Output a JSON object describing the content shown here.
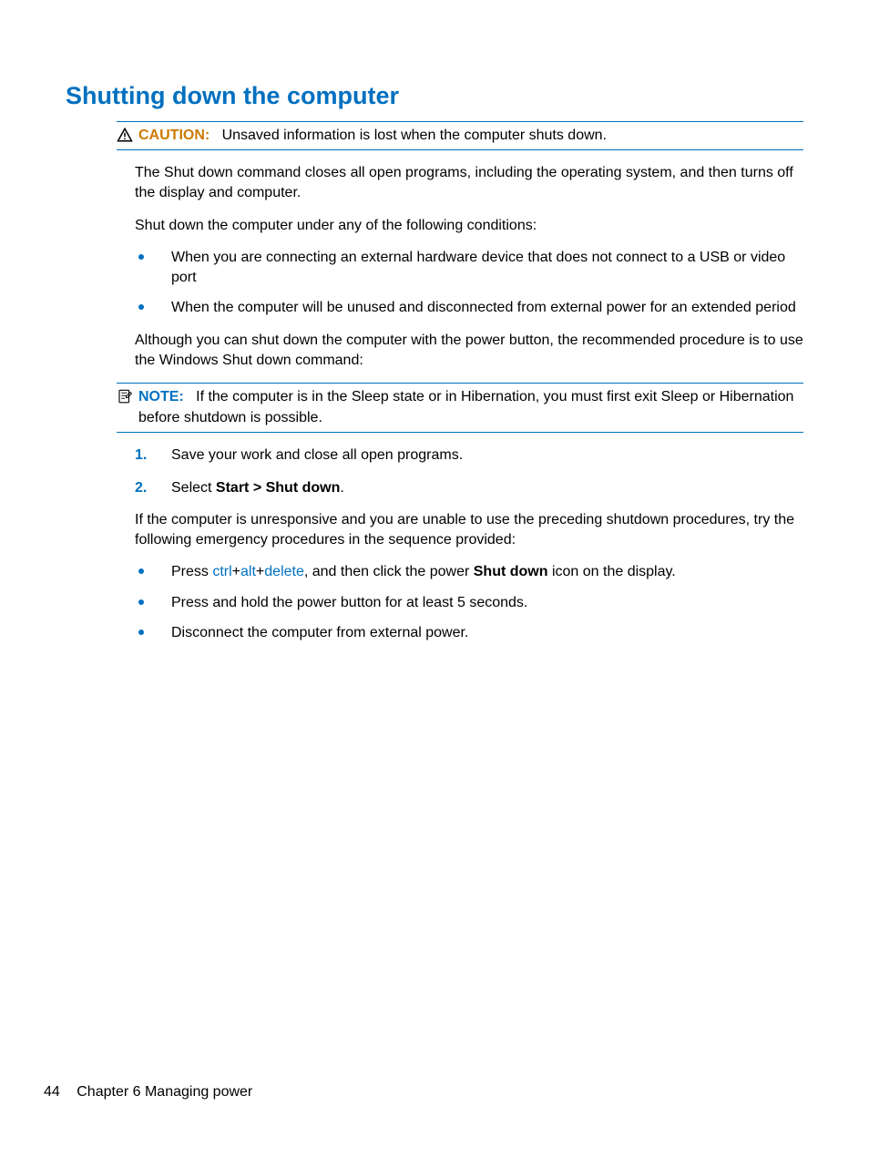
{
  "title": "Shutting down the computer",
  "caution": {
    "label": "CAUTION:",
    "text": "Unsaved information is lost when the computer shuts down."
  },
  "para1": "The Shut down command closes all open programs, including the operating system, and then turns off the display and computer.",
  "para2": "Shut down the computer under any of the following conditions:",
  "conditions": [
    "When you are connecting an external hardware device that does not connect to a USB or video port",
    "When the computer will be unused and disconnected from external power for an extended period"
  ],
  "para3": "Although you can shut down the computer with the power button, the recommended procedure is to use the Windows Shut down command:",
  "note": {
    "label": "NOTE:",
    "text": "If the computer is in the Sleep state or in Hibernation, you must first exit Sleep or Hibernation before shutdown is possible."
  },
  "steps": {
    "s1": "Save your work and close all open programs.",
    "s2_pre": "Select ",
    "s2_bold": "Start > Shut down",
    "s2_post": "."
  },
  "para4": "If the computer is unresponsive and you are unable to use the preceding shutdown procedures, try the following emergency procedures in the sequence provided:",
  "emergency": {
    "e1_pre": "Press ",
    "e1_k1": "ctrl",
    "e1_plus": "+",
    "e1_k2": "alt",
    "e1_k3": "delete",
    "e1_mid": ", and then click the power ",
    "e1_bold": "Shut down",
    "e1_post": " icon on the display.",
    "e2": "Press and hold the power button for at least 5 seconds.",
    "e3": "Disconnect the computer from external power."
  },
  "footer": {
    "page": "44",
    "chapter": "Chapter 6   Managing power"
  }
}
